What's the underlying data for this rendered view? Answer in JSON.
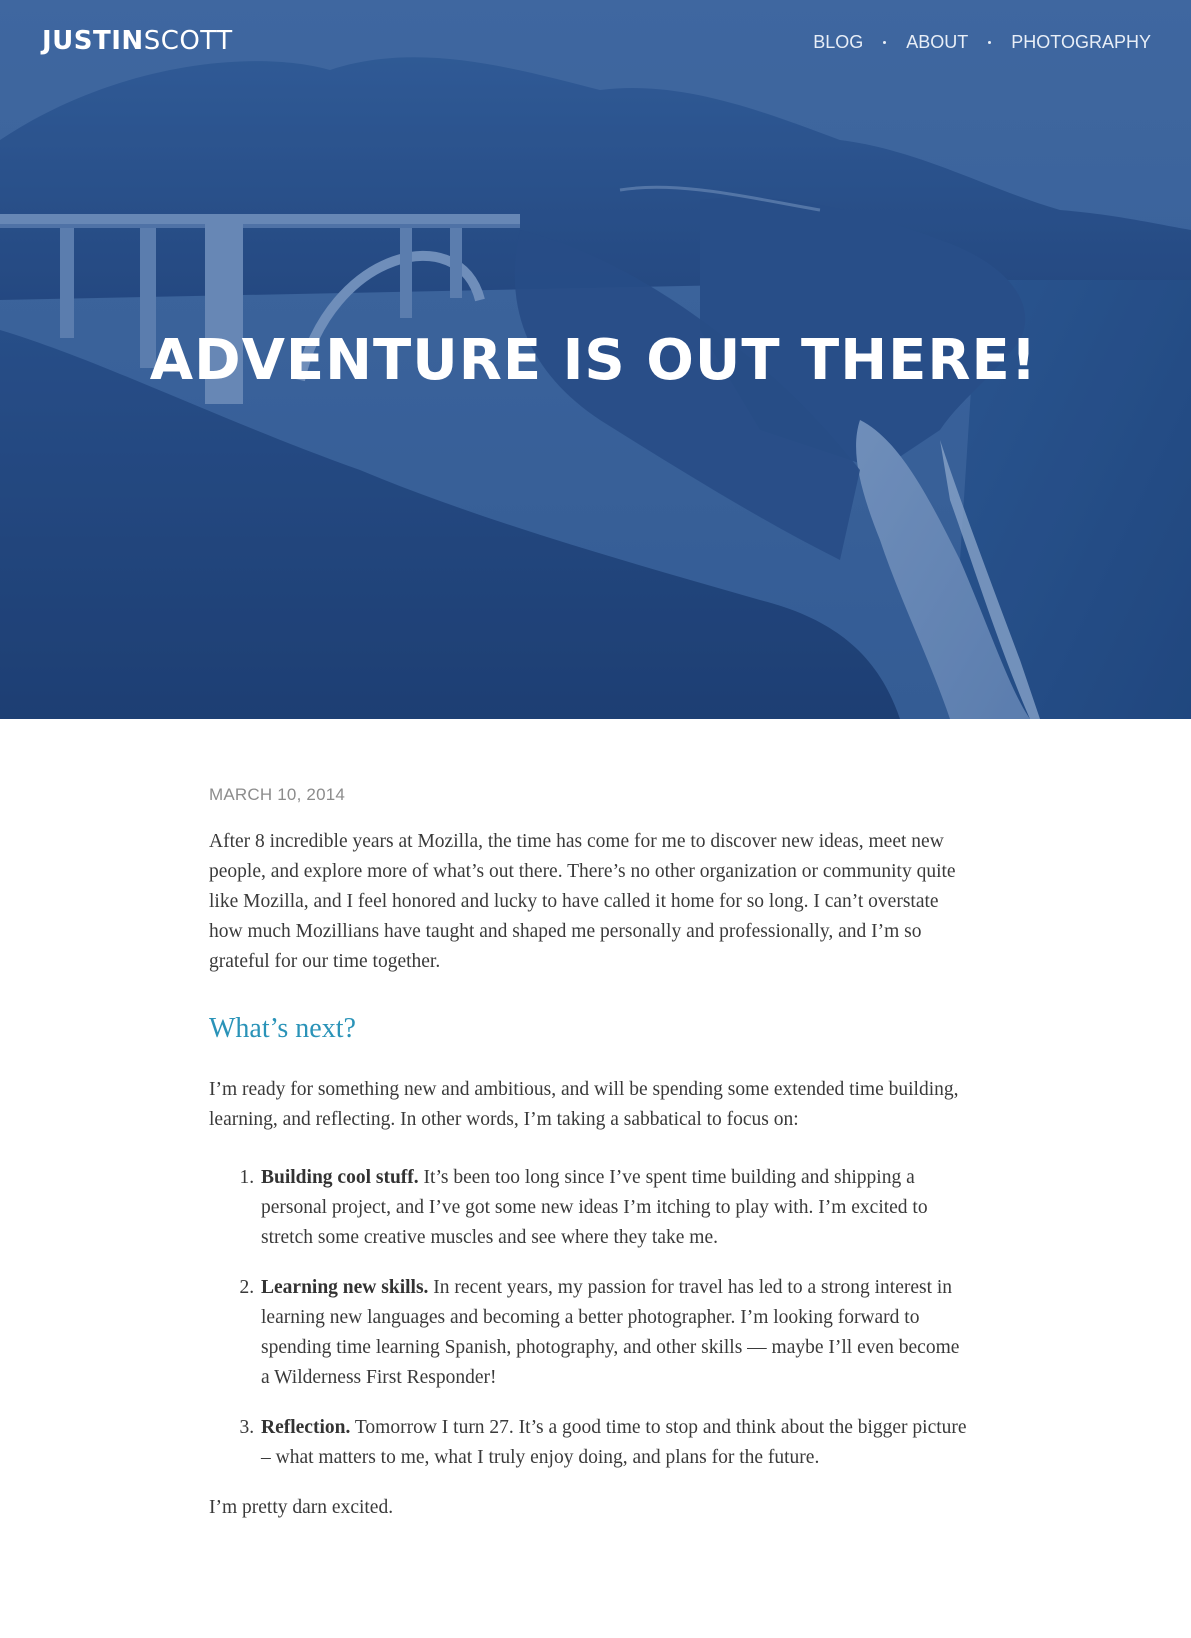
{
  "brand": {
    "first": "JUSTIN",
    "last": "SCOTT"
  },
  "nav": {
    "items": [
      {
        "label": "BLOG"
      },
      {
        "label": "ABOUT"
      },
      {
        "label": "PHOTOGRAPHY"
      }
    ]
  },
  "hero": {
    "title": "ADVENTURE IS OUT THERE!"
  },
  "article": {
    "date": "MARCH 10, 2014",
    "intro": "After 8 incredible years at Mozilla, the time has come for me to discover new ideas, meet new people, and explore more of what’s out there. There’s no other organization or community quite like Mozilla, and I feel honored and lucky to have called it home for so long. I can’t overstate how much Mozillians have taught and shaped me personally and professionally, and I’m so grateful for our time together.",
    "subheading": "What’s next?",
    "lead": "I’m ready for something new and ambitious, and will be spending some extended time building, learning, and reflecting. In other words, I’m taking a sabbatical to focus on:",
    "list": [
      {
        "title": "Building cool stuff.",
        "text": " It’s been too long since I’ve spent time building and shipping a personal project, and I’ve got some new ideas I’m itching to play with. I’m excited to stretch some creative muscles and see where they take me."
      },
      {
        "title": "Learning new skills.",
        "text": " In recent years, my passion for travel has led to a strong interest in learning new languages and becoming a better photographer. I’m looking forward to spending time learning Spanish, photography, and other skills — maybe I’ll even become a Wilderness First Responder!"
      },
      {
        "title": "Reflection.",
        "text": " Tomorrow I turn 27. It’s a good time to stop and think about the bigger picture – what matters to me, what I truly enjoy doing, and plans for the future."
      }
    ],
    "closing": "I’m pretty darn excited."
  },
  "colors": {
    "hero_tint": "#2d558f",
    "heading_accent": "#2a93b8",
    "body_text": "#3a3a3a",
    "date_text": "#8c8c8c"
  }
}
